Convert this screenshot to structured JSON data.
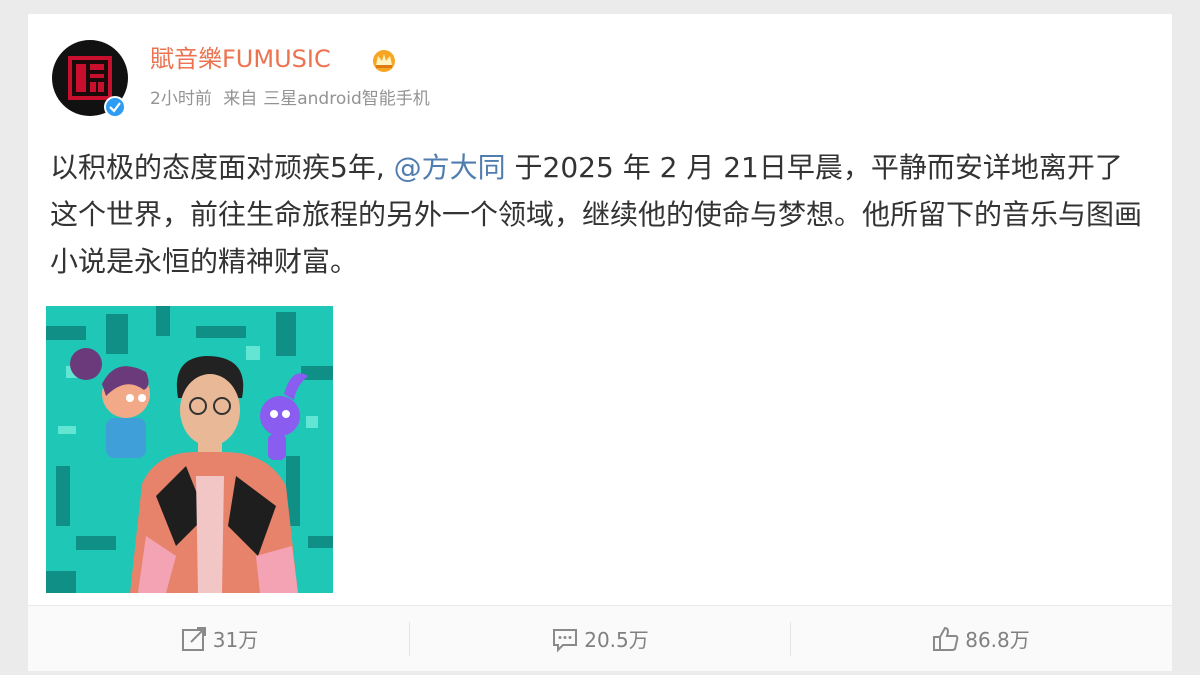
{
  "post": {
    "username": "賦音樂FUMUSIC",
    "time": "2小时前",
    "source_prefix": "来自",
    "source": "三星android智能手机",
    "text_part1": "以积极的态度面对顽疾5年, ",
    "mention": "@方大同",
    "text_part2": " 于2025 年 2 月 21日早晨，平静而安详地离开了这个世界，前往生命旅程的另外一个领域，继续他的使命与梦想。他所留下的音乐与图画小说是永恒的精神财富。"
  },
  "actions": {
    "forward_count": "31万",
    "comment_count": "20.5万",
    "like_count": "86.8万"
  },
  "colors": {
    "username": "#eb7350",
    "mention": "#507daf",
    "meta": "#939393",
    "verified": "#2d9cf5",
    "photo_bg": "#1fc7b6"
  },
  "icons": {
    "avatar": "red-seal-logo",
    "vip": "crown-icon",
    "verified": "verified-badge-icon",
    "forward": "share-icon",
    "comment": "comment-icon",
    "like": "thumbs-up-icon"
  }
}
